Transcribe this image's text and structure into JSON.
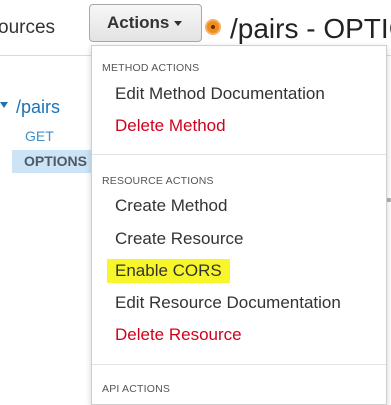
{
  "left_panel": {
    "header_text": "ources",
    "tree_root": "/pairs",
    "methods": [
      "GET",
      "OPTIONS"
    ]
  },
  "toolbar": {
    "actions_label": "Actions",
    "page_title": "/pairs - OPTIC"
  },
  "dropdown": {
    "method_actions_header": "METHOD ACTIONS",
    "method_items": [
      "Edit Method Documentation",
      "Delete Method"
    ],
    "resource_actions_header": "RESOURCE ACTIONS",
    "resource_items": [
      "Create Method",
      "Create Resource",
      "Enable CORS",
      "Edit Resource Documentation",
      "Delete Resource"
    ],
    "api_actions_header": "API ACTIONS"
  },
  "colors": {
    "link": "#1a73b8",
    "danger": "#d0021b",
    "highlight": "#f6f62a",
    "status": "#f08c1e",
    "selected_row": "#cde4f6"
  }
}
